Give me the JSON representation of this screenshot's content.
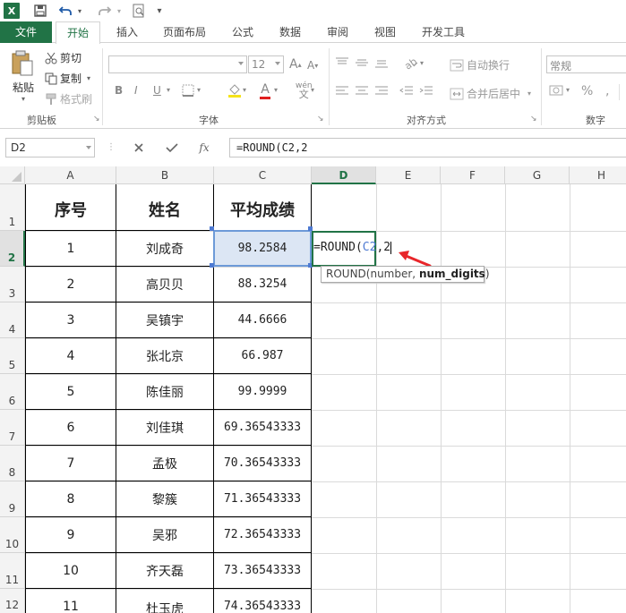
{
  "qat": {
    "app_icon": "X",
    "icons": [
      "excel-icon",
      "save-icon",
      "undo-icon",
      "redo-icon",
      "print-preview-icon",
      "customize-icon"
    ]
  },
  "tabs": [
    {
      "label": "文件"
    },
    {
      "label": "开始"
    },
    {
      "label": "插入"
    },
    {
      "label": "页面布局"
    },
    {
      "label": "公式"
    },
    {
      "label": "数据"
    },
    {
      "label": "审阅"
    },
    {
      "label": "视图"
    },
    {
      "label": "开发工具"
    }
  ],
  "ribbon": {
    "clipboard": {
      "paste": "粘贴",
      "cut": "剪切",
      "copy": "复制",
      "format_painter": "格式刷",
      "group": "剪贴板"
    },
    "font": {
      "size": "12",
      "bold": "B",
      "italic": "I",
      "underline": "U",
      "font_color": "A",
      "phonetic": "wén",
      "group": "字体"
    },
    "alignment": {
      "wrap_text": "自动换行",
      "merge_center": "合并后居中",
      "group": "对齐方式"
    },
    "number": {
      "format": "常规",
      "percent": "%",
      "group": "数字"
    }
  },
  "formula_bar": {
    "name_box": "D2",
    "fx": "fx",
    "formula": "=ROUND(C2,2"
  },
  "columns": [
    "A",
    "B",
    "C",
    "D",
    "E",
    "F",
    "G",
    "H"
  ],
  "rows": [
    "1",
    "2",
    "3",
    "4",
    "5",
    "6",
    "7",
    "8",
    "9",
    "10",
    "11",
    "12"
  ],
  "table": {
    "headers": [
      "序号",
      "姓名",
      "平均成绩"
    ],
    "rows": [
      [
        "1",
        "刘成奇",
        "98.2584"
      ],
      [
        "2",
        "高贝贝",
        "88.3254"
      ],
      [
        "3",
        "吴镇宇",
        "44.6666"
      ],
      [
        "4",
        "张北京",
        "66.987"
      ],
      [
        "5",
        "陈佳丽",
        "99.9999"
      ],
      [
        "6",
        "刘佳琪",
        "69.36543333"
      ],
      [
        "7",
        "孟极",
        "70.36543333"
      ],
      [
        "8",
        "黎簇",
        "71.36543333"
      ],
      [
        "9",
        "吴邪",
        "72.36543333"
      ],
      [
        "10",
        "齐天磊",
        "73.36543333"
      ],
      [
        "11",
        "杜玉虎",
        "74.36543333"
      ]
    ]
  },
  "active_cell": {
    "prefix": "=ROUND(",
    "ref": "C2",
    "suffix": ",2"
  },
  "tooltip": {
    "func": "ROUND(number, ",
    "arg": "num_digits",
    "close": ")"
  },
  "colors": {
    "excel_green": "#217346",
    "ref_blue": "#4e7ad2",
    "arrow_red": "#e8262a"
  }
}
